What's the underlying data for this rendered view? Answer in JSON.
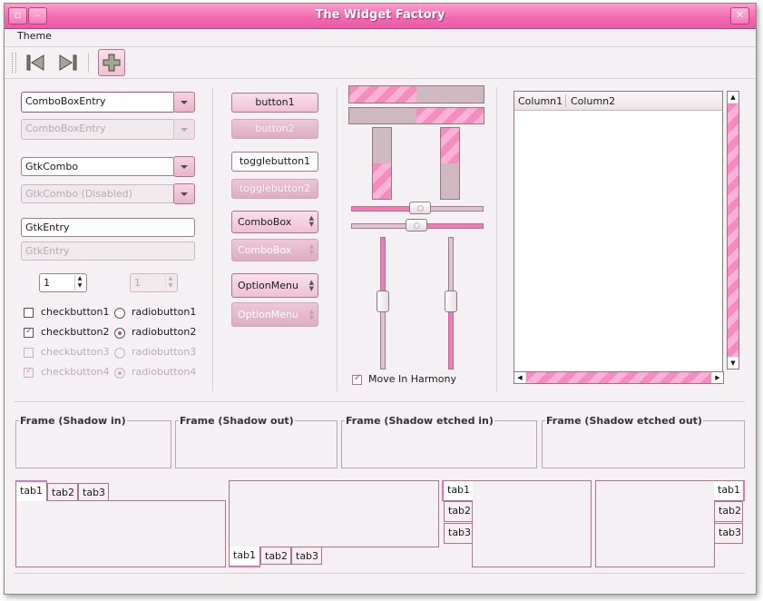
{
  "window": {
    "title": "The Widget Factory"
  },
  "menu": {
    "theme": "Theme"
  },
  "entries": {
    "combo_entry": "ComboBoxEntry",
    "combo_entry_disabled": "ComboBoxEntry",
    "gtk_combo": "GtkCombo",
    "gtk_combo_disabled": "GtkCombo (Disabled)",
    "gtk_entry": "GtkEntry",
    "gtk_entry_disabled": "GtkEntry"
  },
  "spin": {
    "value": "1",
    "value_disabled": "1"
  },
  "checks": {
    "c1": "checkbutton1",
    "c2": "checkbutton2",
    "c3": "checkbutton3",
    "c4": "checkbutton4",
    "r1": "radiobutton1",
    "r2": "radiobutton2",
    "r3": "radiobutton3",
    "r4": "radiobutton4"
  },
  "buttons": {
    "b1": "button1",
    "b2": "button2",
    "t1": "togglebutton1",
    "t2": "togglebutton2",
    "cb1": "ComboBox",
    "cb2": "ComboBox",
    "om1": "OptionMenu",
    "om2": "OptionMenu"
  },
  "progress": {
    "h1": 0.5,
    "h2": 0.5,
    "v1": 0.5,
    "v2": 0.5
  },
  "harmony": "Move In Harmony",
  "tree": {
    "col1": "Column1",
    "col2": "Column2"
  },
  "frames": {
    "f1": "Frame (Shadow in)",
    "f2": "Frame (Shadow out)",
    "f3": "Frame (Shadow etched in)",
    "f4": "Frame (Shadow etched out)"
  },
  "tabs": {
    "t1": "tab1",
    "t2": "tab2",
    "t3": "tab3"
  },
  "colors": {
    "accent": "#f26bb0",
    "border": "#b0738f"
  }
}
